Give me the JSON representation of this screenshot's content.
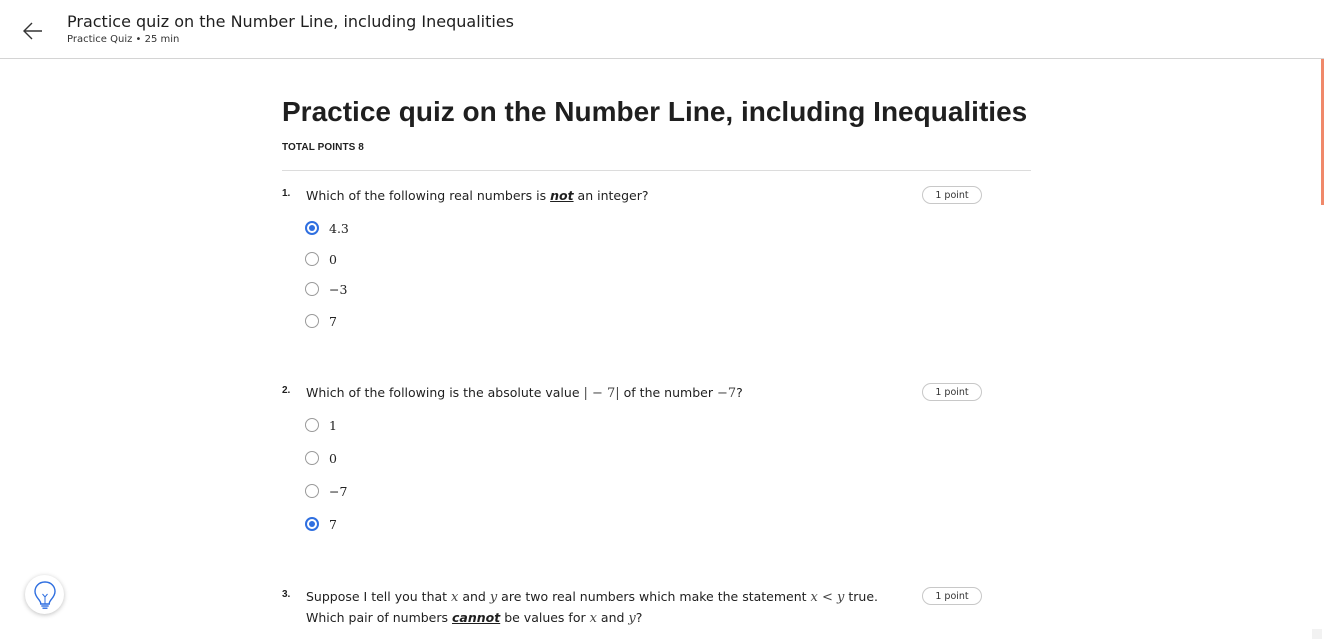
{
  "header": {
    "title": "Practice quiz on the Number Line, including Inequalities",
    "subtitle": "Practice Quiz • 25 min"
  },
  "quiz": {
    "title": "Practice quiz on the Number Line, including Inequalities",
    "total_points": "TOTAL POINTS 8"
  },
  "questions": [
    {
      "number": "1.",
      "text_before": "Which of the following real numbers is ",
      "keyword": "not",
      "text_after": " an integer?",
      "points": "1 point",
      "options": [
        {
          "label": "4.3",
          "selected": true
        },
        {
          "label": "0",
          "selected": false
        },
        {
          "label": "−3",
          "selected": false
        },
        {
          "label": "7",
          "selected": false
        }
      ]
    },
    {
      "number": "2.",
      "text_before": "Which of the following is the absolute value ",
      "math_1": "| − 7|",
      "text_mid": " of the number ",
      "math_2": "−7",
      "text_after": "?",
      "points": "1 point",
      "options": [
        {
          "label": "1",
          "selected": false
        },
        {
          "label": "0",
          "selected": false
        },
        {
          "label": "−7",
          "selected": false
        },
        {
          "label": "7",
          "selected": true
        }
      ]
    },
    {
      "number": "3.",
      "line1_a": "Suppose I tell you that ",
      "var_x": "x",
      "line1_b": " and ",
      "var_y": "y",
      "line1_c": " are two real numbers which make the statement ",
      "math_ineq": "x < y",
      "line1_d": " true.",
      "line2_a": "Which pair of numbers ",
      "keyword": "cannot",
      "line2_b": " be values for ",
      "line2_c": " and ",
      "line2_d": "?",
      "points": "1 point"
    }
  ],
  "icons": {
    "back": "arrow-left-icon",
    "hint": "lightbulb-icon"
  },
  "colors": {
    "accent_blue": "#2f6fe0",
    "scroll_orange": "#f0896a"
  }
}
